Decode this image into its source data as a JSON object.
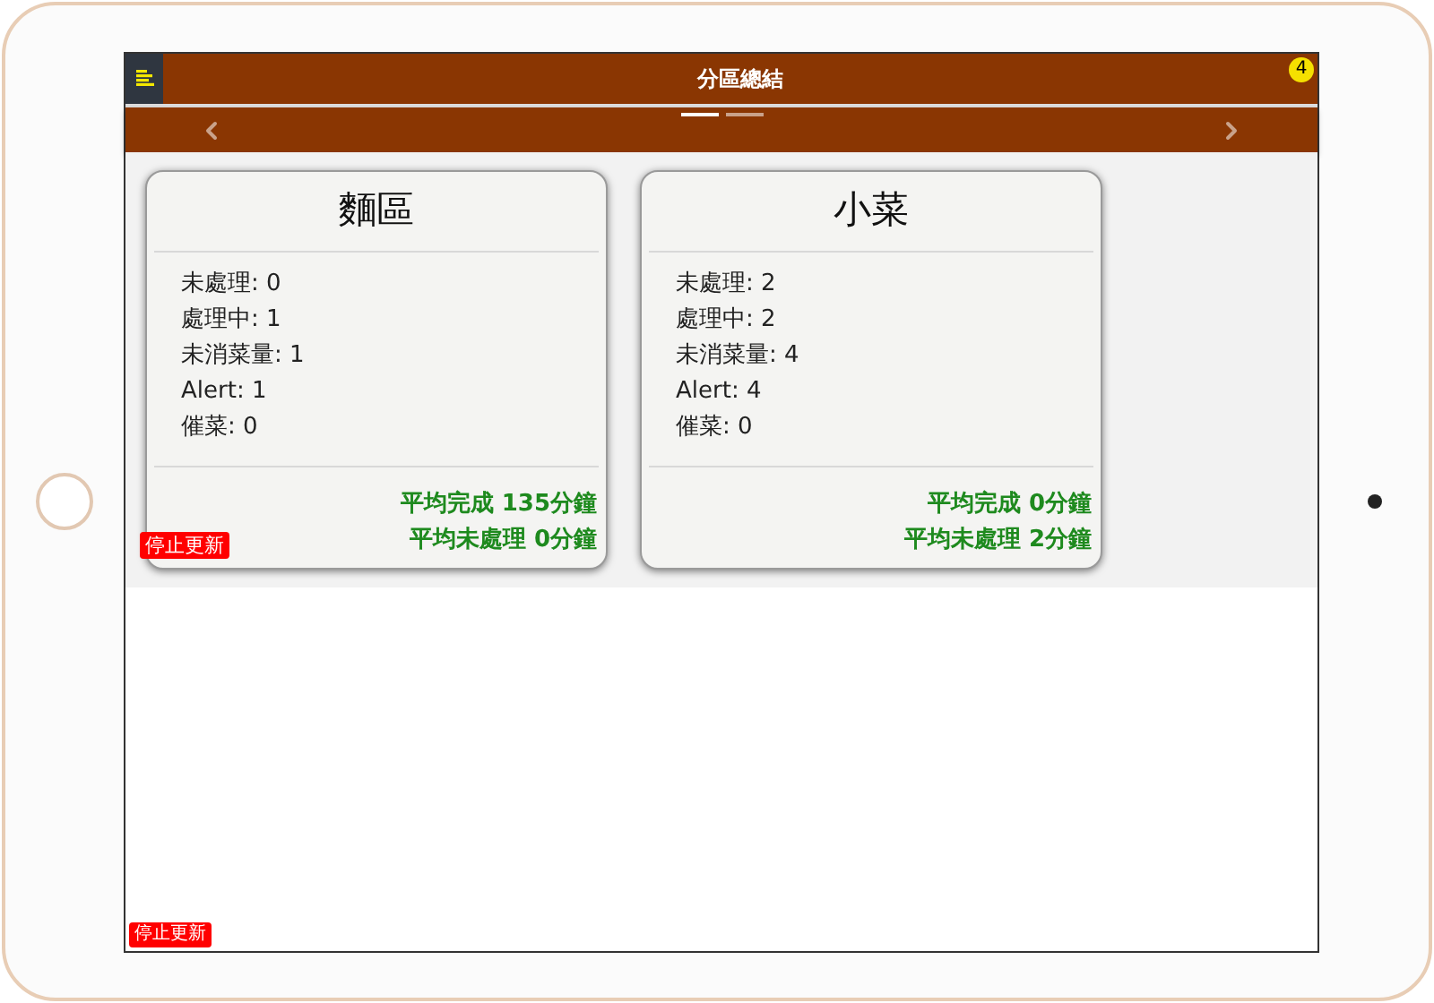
{
  "header": {
    "title": "分區總結",
    "badge": "4"
  },
  "pager": [
    {
      "selected": true
    },
    {
      "selected": false
    }
  ],
  "cards": [
    {
      "title": "麵區",
      "stats": [
        "未處理: 0",
        "處理中: 1",
        "未消菜量: 1",
        "Alert: 1",
        "催菜: 0"
      ],
      "footer": [
        "平均完成 135分鐘",
        "平均未處理 0分鐘"
      ]
    },
    {
      "title": "小菜",
      "stats": [
        "未處理: 2",
        "處理中: 2",
        "未消菜量: 4",
        "Alert: 4",
        "催菜: 0"
      ],
      "footer": [
        "平均完成 0分鐘",
        "平均未處理 2分鐘"
      ]
    }
  ],
  "stop_buttons": [
    "停止更新",
    "停止更新"
  ]
}
